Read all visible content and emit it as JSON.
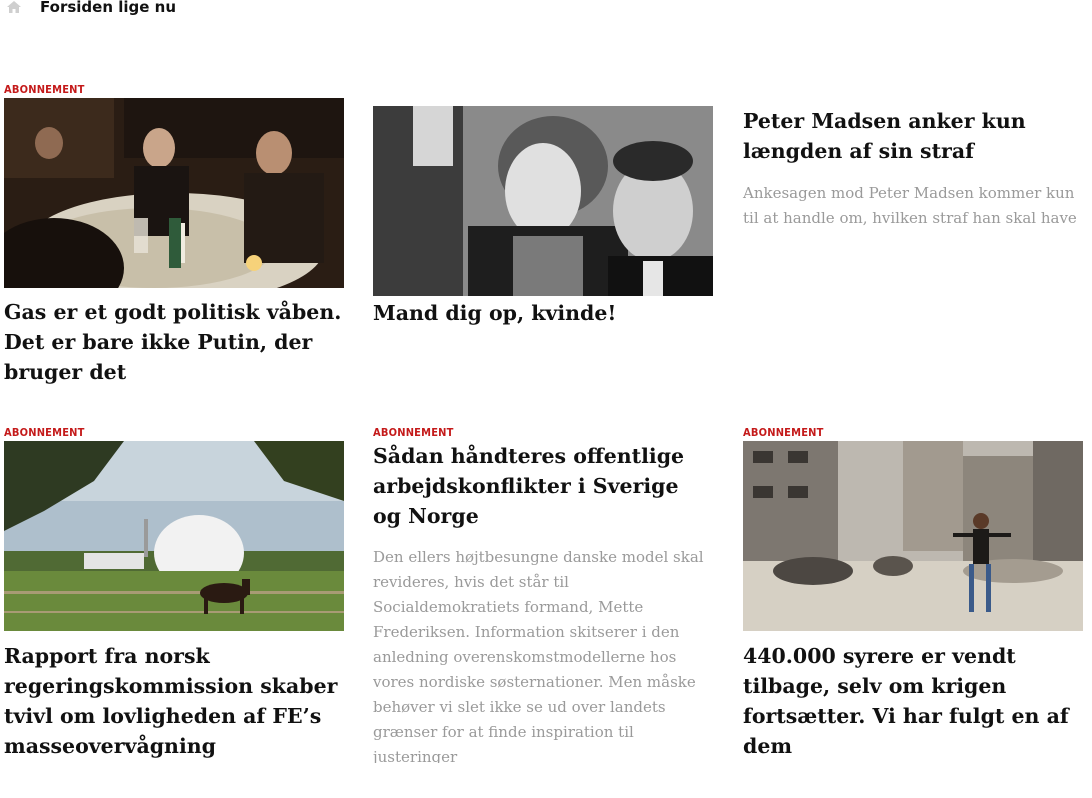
{
  "topbar": {
    "label": "Forsiden lige nu",
    "icon": "home-icon"
  },
  "colors": {
    "kicker": "#c41a1a",
    "teaser": "#9a9a9a",
    "headline": "#111111"
  },
  "articles": [
    {
      "kicker": "ABONNEMENT",
      "headline": "Gas er et godt politisk våben. Det er bare ikke Putin, der bruger det",
      "image": "dinner-table-photo"
    },
    {
      "headline": "Mand dig op, kvinde!",
      "image": "black-white-couple-photo"
    },
    {
      "headline": "Peter Madsen anker kun længden af sin straf",
      "teaser": "Ankesagen mod Peter Madsen kommer kun til at handle om, hvilken straf han skal have"
    },
    {
      "kicker": "ABONNEMENT",
      "headline": "Rapport fra norsk regeringskommission skaber tvivl om lovligheden af FE’s masseovervågning",
      "image": "radar-dome-horse-photo"
    },
    {
      "kicker": "ABONNEMENT",
      "headline": "Sådan håndteres offentlige arbejdskonflikter i Sverige og Norge",
      "teaser": "Den ellers højtbesungne danske model skal revideres, hvis det står til Socialdemokratiets formand, Mette Frederiksen. Information skitserer i den anledning overenskomstmodellerne hos vores nordiske søsternationer. Men måske behøver vi slet ikke se ud over landets grænser for at finde inspiration til justeringer"
    },
    {
      "kicker": "ABONNEMENT",
      "headline": "440.000 syrere er vendt tilbage, selv om krigen fortsætter. Vi har fulgt en af dem",
      "image": "war-ruins-child-photo"
    }
  ]
}
